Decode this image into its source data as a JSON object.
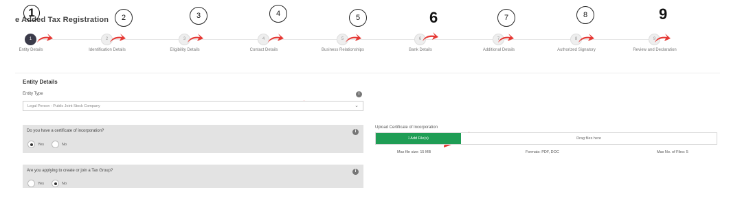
{
  "page": {
    "title": "e Added Tax Registration"
  },
  "stepper": {
    "steps": [
      {
        "number": "1",
        "label": "Entity Details",
        "active": true
      },
      {
        "number": "2",
        "label": "Identification Details",
        "active": false
      },
      {
        "number": "3",
        "label": "Eligibility Details",
        "active": false
      },
      {
        "number": "4",
        "label": "Contact Details",
        "active": false
      },
      {
        "number": "5",
        "label": "Business Relationships",
        "active": false
      },
      {
        "number": "6",
        "label": "Bank Details",
        "active": false
      },
      {
        "number": "7",
        "label": "Additional Details",
        "active": false
      },
      {
        "number": "8",
        "label": "Authorized Signatory",
        "active": false
      },
      {
        "number": "9",
        "label": "Review and Declaration",
        "active": false
      }
    ]
  },
  "annotations": {
    "markers": [
      "1",
      "2",
      "3",
      "4",
      "5",
      "6",
      "7",
      "8",
      "9"
    ],
    "arrow_color": "#e53935"
  },
  "form": {
    "section_title": "Entity Details",
    "entity_type": {
      "label": "Entity Type",
      "value": "Legal Person - Public Joint Stock Company"
    },
    "certificate_question": {
      "text": "Do you have a certificate of incorporation?",
      "options": [
        {
          "label": "Yes",
          "checked": true
        },
        {
          "label": "No",
          "checked": false
        }
      ]
    },
    "tax_group_question": {
      "text": "Are you applying to create or join a Tax Group?",
      "options": [
        {
          "label": "Yes",
          "checked": false
        },
        {
          "label": "No",
          "checked": true
        }
      ]
    },
    "upload": {
      "label": "Upload Certificate of Incorporation",
      "button_label": "Add File(s)",
      "drop_text": "Drag files here",
      "max_size": "Max file size: 15 MB",
      "formats": "Formats: PDF, DOC",
      "max_files": "Max No. of Files: 5"
    }
  },
  "colors": {
    "accent_green": "#1f9d55",
    "active_step": "#3b3b4a",
    "question_bg": "#e3e3e3"
  },
  "icons": {
    "info": "info-icon",
    "chevron": "chevron-down-icon",
    "upload": "upload-icon"
  }
}
